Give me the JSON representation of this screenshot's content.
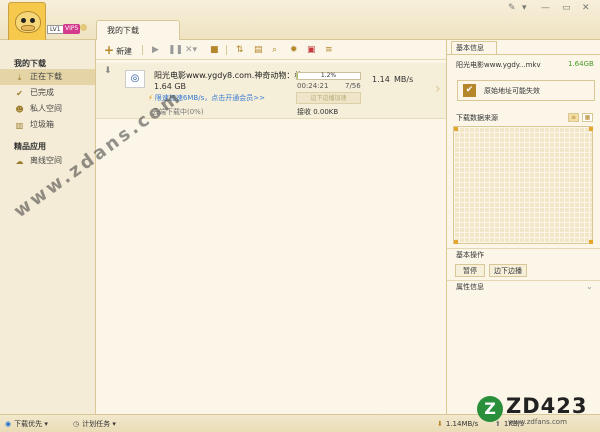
{
  "header": {
    "level": "LV1",
    "vip": "VIP5",
    "tab_label": "我的下载"
  },
  "toolbar": {
    "new_label": "新建",
    "icons": [
      "play-icon",
      "pause-icon",
      "delete-icon",
      "folder-icon",
      "sort-icon",
      "info-icon",
      "search-icon",
      "settings-icon",
      "vip-icon",
      "collapse-icon"
    ]
  },
  "sidebar": {
    "section1_title": "我的下载",
    "items": [
      {
        "label": "正在下载"
      },
      {
        "label": "已完成"
      },
      {
        "label": "私人空间"
      },
      {
        "label": "垃圾箱"
      }
    ],
    "section2_title": "精品应用",
    "apps": [
      {
        "label": "离线空间"
      }
    ]
  },
  "task": {
    "name": "阳光电影www.ygdy8.com.神奇动物：格...",
    "size": "1.64 GB",
    "accelerate": "限速加速6MB/s，点击开通会员>>",
    "progress_pct": "1.2%",
    "progress": 0.012,
    "elapsed": "00:24:21",
    "pieces": "7/56",
    "speed": "1.14",
    "speed_unit": "MB/s",
    "play_label": "边下边播加速",
    "cloud": "云端下载中(0%)",
    "upload": "接收 0.00KB"
  },
  "right_panel": {
    "tab": "基本信息",
    "file_name": "阳光电影www.ygdy...mkv",
    "file_size": "1.64GB",
    "addr_warning": "原始地址可能失效",
    "source_title": "下载数据来源",
    "ops_title": "基本操作",
    "pause_label": "暂停",
    "play_label": "边下边播",
    "attr_title": "属性信息"
  },
  "status": {
    "priority": "下载优先",
    "schedule": "计划任务",
    "speed": "1.14MB/s",
    "upload": "1KB/s"
  },
  "watermark": {
    "diagonal": "www.zdans.com",
    "logo": "ZD423",
    "logo_url": "www.zdfans.com"
  }
}
